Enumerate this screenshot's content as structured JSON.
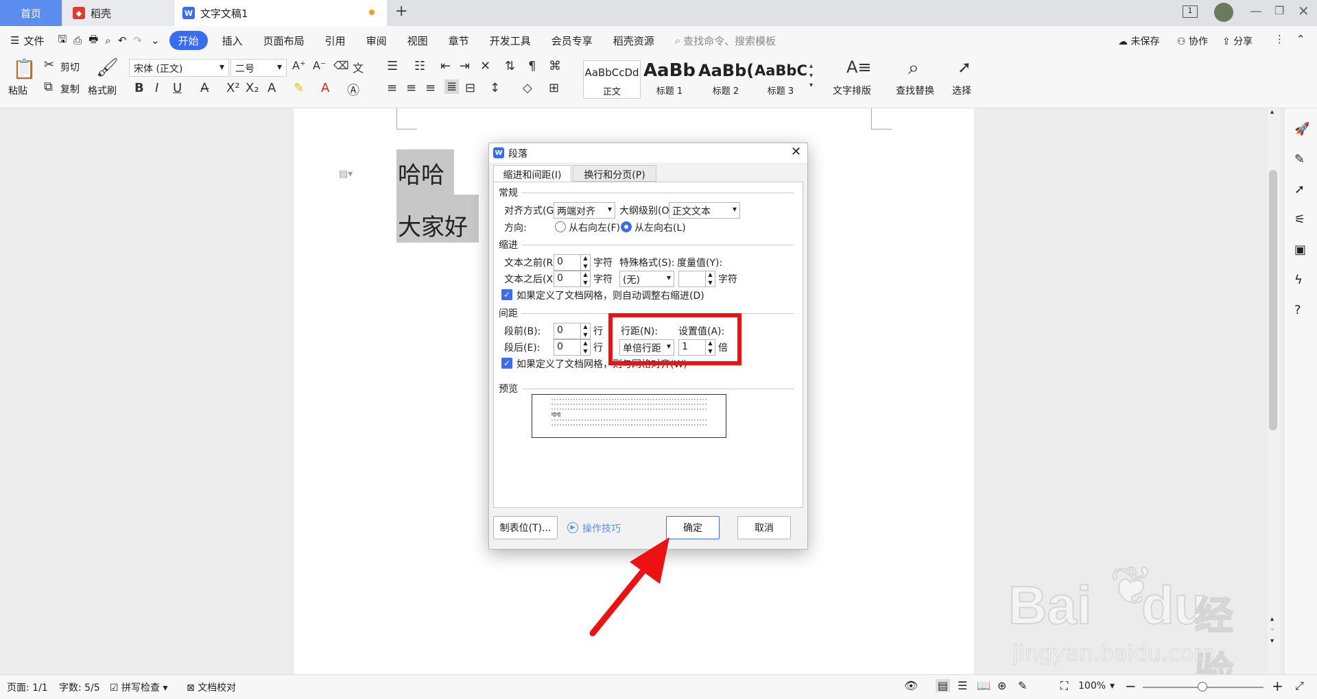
{
  "tabs": {
    "home": "首页",
    "daoke": "稻壳",
    "doc": "文字文稿1",
    "add": "+"
  },
  "menubar": {
    "file": "文件",
    "items": [
      "开始",
      "插入",
      "页面布局",
      "引用",
      "审阅",
      "视图",
      "章节",
      "开发工具",
      "会员专享",
      "稻壳资源"
    ],
    "search": "查找命令、搜索模板",
    "unsaved": "未保存",
    "collab": "协作",
    "share": "分享"
  },
  "ribbon": {
    "paste": "粘贴",
    "cut": "剪切",
    "copy": "复制",
    "format_painter": "格式刷",
    "font": "宋体 (正文)",
    "size": "二号",
    "styles": [
      {
        "sample": "AaBbCcDd",
        "name": "正文"
      },
      {
        "sample": "AaBb",
        "name": "标题 1"
      },
      {
        "sample": "AaBb(",
        "name": "标题 2"
      },
      {
        "sample": "AaBbC",
        "name": "标题 3"
      }
    ],
    "text_layout": "文字排版",
    "find_replace": "查找替换",
    "select": "选择"
  },
  "document": {
    "line1": "哈哈",
    "line2": "大家好"
  },
  "dialog": {
    "title": "段落",
    "tabs": [
      "缩进和间距(I)",
      "换行和分页(P)"
    ],
    "general": {
      "header": "常规",
      "align_label": "对齐方式(G):",
      "align_value": "两端对齐",
      "outline_label": "大纲级别(O):",
      "outline_value": "正文文本",
      "direction_label": "方向:",
      "rtl": "从右向左(F)",
      "ltr": "从左向右(L)"
    },
    "indent": {
      "header": "缩进",
      "before_label": "文本之前(R):",
      "before_value": "0",
      "after_label": "文本之后(X):",
      "after_value": "0",
      "unit": "字符",
      "special_label": "特殊格式(S):",
      "special_value": "(无)",
      "measure_label": "度量值(Y):",
      "measure_value": "",
      "auto_adjust": "如果定义了文档网格，则自动调整右缩进(D)"
    },
    "spacing": {
      "header": "间距",
      "before_label": "段前(B):",
      "before_value": "0",
      "after_label": "段后(E):",
      "after_value": "0",
      "unit": "行",
      "line_label": "行距(N):",
      "line_value": "单倍行距",
      "setting_label": "设置值(A):",
      "setting_value": "1",
      "setting_unit": "倍",
      "snap_grid": "如果定义了文档网格，则与网格对齐(W)"
    },
    "preview": {
      "header": "预览",
      "text": "哈哈"
    },
    "buttons": {
      "tabs": "制表位(T)...",
      "tips": "操作技巧",
      "ok": "确定",
      "cancel": "取消"
    }
  },
  "statusbar": {
    "page": "页面: 1/1",
    "words": "字数: 5/5",
    "spell": "拼写检查",
    "proof": "文档校对",
    "zoom": "100%"
  },
  "watermark": {
    "brand": "Bai",
    "brand2": "du",
    "cn": "经验",
    "url": "jingyan.baidu.com"
  },
  "colors": {
    "accent": "#3a6cf2",
    "highlight_box": "#ee1111",
    "arrow": "#ee1111"
  }
}
